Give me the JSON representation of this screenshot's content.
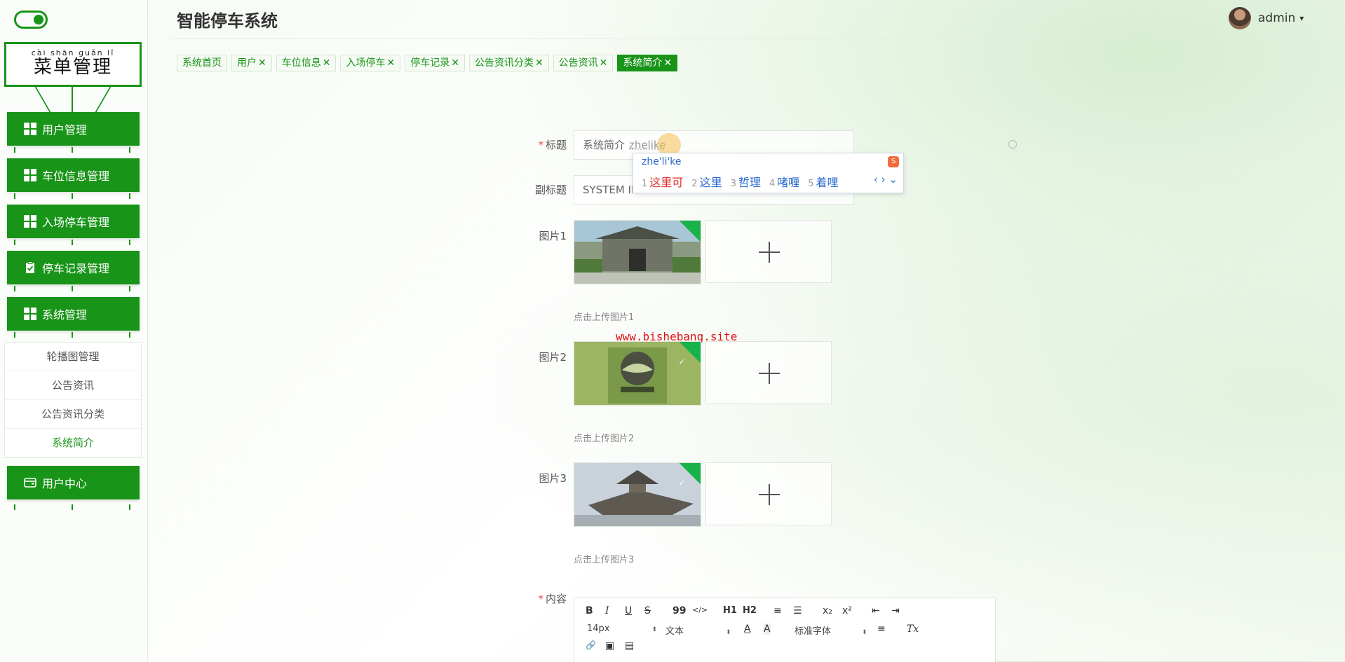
{
  "header": {
    "app_title": "智能停车系统",
    "user_name": "admin",
    "caret": "⌄"
  },
  "sidebar": {
    "menu_title_pinyin": "cài  shān  guǎn   lǐ",
    "menu_title": "菜单管理",
    "items": [
      {
        "label": "用户管理",
        "icon": "grid-icon"
      },
      {
        "label": "车位信息管理",
        "icon": "grid-icon"
      },
      {
        "label": "入场停车管理",
        "icon": "grid-icon"
      },
      {
        "label": "停车记录管理",
        "icon": "clipboard-check-icon"
      },
      {
        "label": "系统管理",
        "icon": "grid-icon"
      },
      {
        "label": "用户中心",
        "icon": "wallet-icon"
      }
    ],
    "submenu": [
      {
        "label": "轮播图管理"
      },
      {
        "label": "公告资讯"
      },
      {
        "label": "公告资讯分类"
      },
      {
        "label": "系统简介",
        "active": true
      }
    ]
  },
  "tags": [
    {
      "label": "系统首页"
    },
    {
      "label": "用户",
      "close": "✕"
    },
    {
      "label": "车位信息",
      "close": "✕"
    },
    {
      "label": "入场停车",
      "close": "✕"
    },
    {
      "label": "停车记录",
      "close": "✕"
    },
    {
      "label": "公告资讯分类",
      "close": "✕"
    },
    {
      "label": "公告资讯",
      "close": "✕"
    },
    {
      "label": "系统简介",
      "close": "✕",
      "active": true
    }
  ],
  "form": {
    "title_label": "标题",
    "title_value": "系统简介",
    "title_composing": "zhelike",
    "subtitle_label": "副标题",
    "subtitle_value": "SYSTEM INTRODUCTION",
    "pic1_label": "图片1",
    "pic2_label": "图片2",
    "pic3_label": "图片3",
    "pic1_hint": "点击上传图片1",
    "pic2_hint": "点击上传图片2",
    "pic3_hint": "点击上传图片3",
    "content_label": "内容",
    "required_mark": "*",
    "upload_plus": "+"
  },
  "ime": {
    "pinyin": "zhe'li'ke",
    "candidates": [
      {
        "n": "1",
        "text": "这里可"
      },
      {
        "n": "2",
        "text": "这里"
      },
      {
        "n": "3",
        "text": "哲理"
      },
      {
        "n": "4",
        "text": "啫喱"
      },
      {
        "n": "5",
        "text": "着哩"
      }
    ],
    "nav": "‹ › ⌄"
  },
  "watermark": "www.bishebang.site",
  "editor": {
    "row1": [
      "B",
      "I",
      "U",
      "S",
      "99",
      "</>",
      "H1",
      "H2",
      "≡",
      "☰",
      "x₂",
      "x²",
      "⇤",
      "⇥"
    ],
    "font_size": "14px",
    "header_select": "文本",
    "font_family": "标准字体",
    "row2_icons": [
      "A",
      "A",
      "≡",
      "Tx"
    ],
    "row3_icons": [
      "🔗",
      "▣",
      "▤"
    ]
  },
  "colors": {
    "primary": "#189418",
    "tag_bg": "#f5faf3",
    "ime_candidate": "#2a6acc",
    "ime_first": "#e0322b",
    "watermark": "#e01010"
  }
}
